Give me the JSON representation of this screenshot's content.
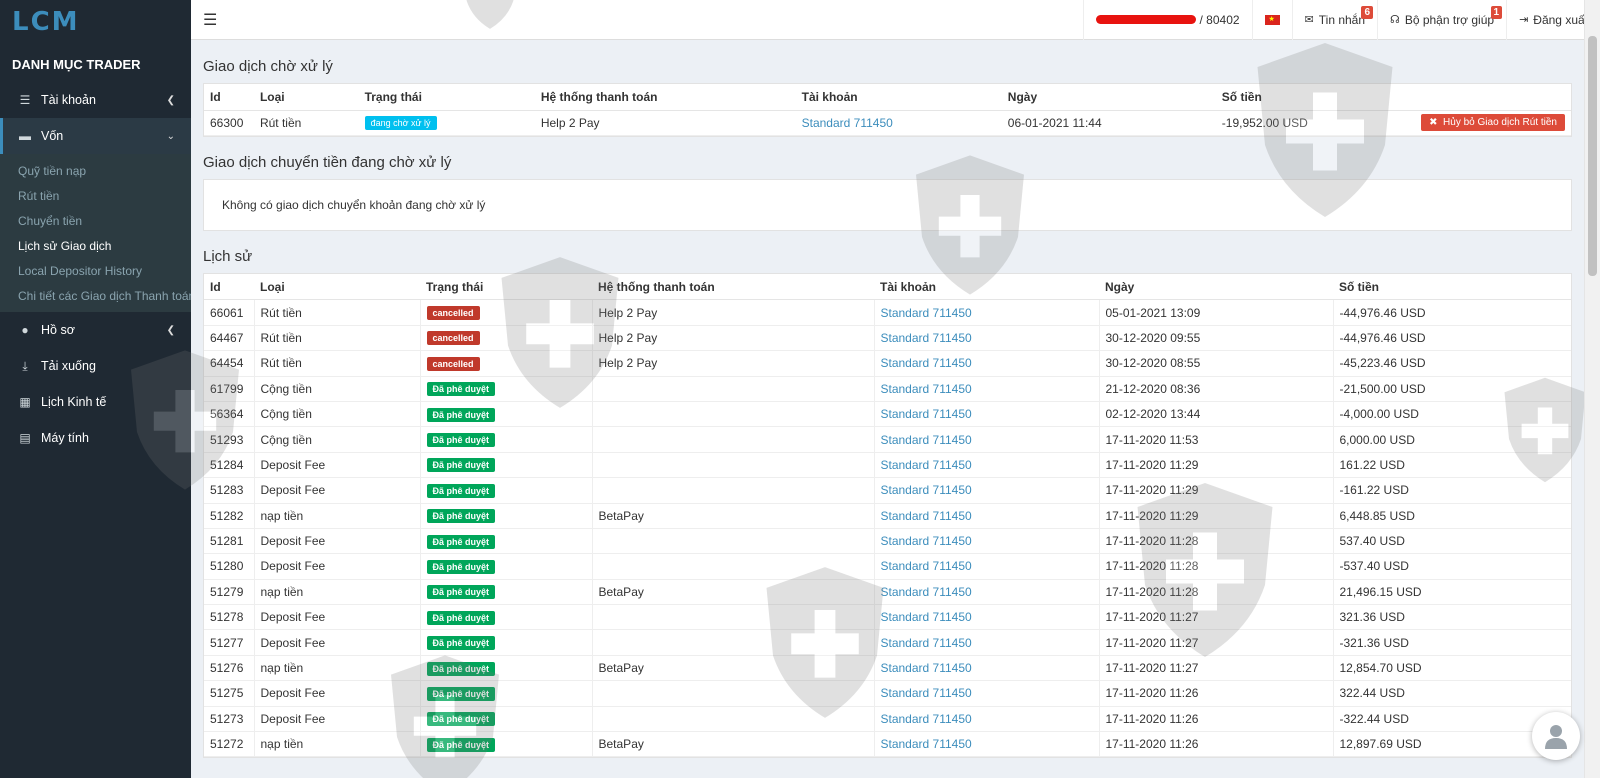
{
  "brand": {
    "logo": "LCM"
  },
  "sidebar": {
    "header": "DANH MỤC TRADER",
    "items": [
      {
        "label": "Tài khoản",
        "icon": "list-icon"
      },
      {
        "label": "Vốn",
        "icon": "wallet-icon"
      },
      {
        "label": "Hồ sơ",
        "icon": "user-icon"
      },
      {
        "label": "Tải xuống",
        "icon": "download-icon"
      },
      {
        "label": "Lịch Kinh tế",
        "icon": "calendar-icon"
      },
      {
        "label": "Máy tính",
        "icon": "calculator-icon"
      }
    ],
    "sub_items": [
      "Quỹ tiền nạp",
      "Rút tiền",
      "Chuyển tiền",
      "Lịch sử Giao dịch",
      "Local Depositor History",
      "Chi tiết các Giao dịch Thanh toán"
    ]
  },
  "topbar": {
    "account_suffix": "/ 80402",
    "messages_label": "Tin nhắn",
    "messages_count": "6",
    "support_label": "Bộ phận trợ giúp",
    "support_count": "1",
    "logout_label": "Đăng xuất"
  },
  "pending": {
    "title": "Giao dịch chờ xử lý",
    "headers": [
      "Id",
      "Loại",
      "Trạng thái",
      "Hệ thống thanh toán",
      "Tài khoản",
      "Ngày",
      "Số tiền"
    ],
    "row": {
      "id": "66300",
      "type": "Rút tiền",
      "status": "đang chờ xử lý",
      "system": "Help 2 Pay",
      "account": "Standard 711450",
      "date": "06-01-2021 11:44",
      "amount": "-19,952.00 USD",
      "cancel_button": "Hủy bỏ Giao dịch Rút tiền"
    }
  },
  "transfers": {
    "title": "Giao dịch chuyển tiền đang chờ xử lý",
    "empty": "Không có giao dịch chuyển khoản đang chờ xử lý"
  },
  "history": {
    "title": "Lịch sử",
    "headers": [
      "Id",
      "Loại",
      "Trạng thái",
      "Hệ thống thanh toán",
      "Tài khoản",
      "Ngày",
      "Số tiền"
    ],
    "rows": [
      {
        "id": "66061",
        "type": "Rút tiền",
        "status": "cancelled",
        "system": "Help 2 Pay",
        "account": "Standard 711450",
        "date": "05-01-2021 13:09",
        "amount": "-44,976.46 USD"
      },
      {
        "id": "64467",
        "type": "Rút tiền",
        "status": "cancelled",
        "system": "Help 2 Pay",
        "account": "Standard 711450",
        "date": "30-12-2020 09:55",
        "amount": "-44,976.46 USD"
      },
      {
        "id": "64454",
        "type": "Rút tiền",
        "status": "cancelled",
        "system": "Help 2 Pay",
        "account": "Standard 711450",
        "date": "30-12-2020 08:55",
        "amount": "-45,223.46 USD"
      },
      {
        "id": "61799",
        "type": "Cộng tiền",
        "status": "Đã phê duyệt",
        "system": "",
        "account": "Standard 711450",
        "date": "21-12-2020 08:36",
        "amount": "-21,500.00 USD"
      },
      {
        "id": "56364",
        "type": "Cộng tiền",
        "status": "Đã phê duyệt",
        "system": "",
        "account": "Standard 711450",
        "date": "02-12-2020 13:44",
        "amount": "-4,000.00 USD"
      },
      {
        "id": "51293",
        "type": "Cộng tiền",
        "status": "Đã phê duyệt",
        "system": "",
        "account": "Standard 711450",
        "date": "17-11-2020 11:53",
        "amount": "6,000.00 USD"
      },
      {
        "id": "51284",
        "type": "Deposit Fee",
        "status": "Đã phê duyệt",
        "system": "",
        "account": "Standard 711450",
        "date": "17-11-2020 11:29",
        "amount": "161.22 USD"
      },
      {
        "id": "51283",
        "type": "Deposit Fee",
        "status": "Đã phê duyệt",
        "system": "",
        "account": "Standard 711450",
        "date": "17-11-2020 11:29",
        "amount": "-161.22 USD"
      },
      {
        "id": "51282",
        "type": "nạp tiền",
        "status": "Đã phê duyệt",
        "system": "BetaPay",
        "account": "Standard 711450",
        "date": "17-11-2020 11:29",
        "amount": "6,448.85 USD"
      },
      {
        "id": "51281",
        "type": "Deposit Fee",
        "status": "Đã phê duyệt",
        "system": "",
        "account": "Standard 711450",
        "date": "17-11-2020 11:28",
        "amount": "537.40 USD"
      },
      {
        "id": "51280",
        "type": "Deposit Fee",
        "status": "Đã phê duyệt",
        "system": "",
        "account": "Standard 711450",
        "date": "17-11-2020 11:28",
        "amount": "-537.40 USD"
      },
      {
        "id": "51279",
        "type": "nạp tiền",
        "status": "Đã phê duyệt",
        "system": "BetaPay",
        "account": "Standard 711450",
        "date": "17-11-2020 11:28",
        "amount": "21,496.15 USD"
      },
      {
        "id": "51278",
        "type": "Deposit Fee",
        "status": "Đã phê duyệt",
        "system": "",
        "account": "Standard 711450",
        "date": "17-11-2020 11:27",
        "amount": "321.36 USD"
      },
      {
        "id": "51277",
        "type": "Deposit Fee",
        "status": "Đã phê duyệt",
        "system": "",
        "account": "Standard 711450",
        "date": "17-11-2020 11:27",
        "amount": "-321.36 USD"
      },
      {
        "id": "51276",
        "type": "nạp tiền",
        "status": "Đã phê duyệt",
        "system": "BetaPay",
        "account": "Standard 711450",
        "date": "17-11-2020 11:27",
        "amount": "12,854.70 USD"
      },
      {
        "id": "51275",
        "type": "Deposit Fee",
        "status": "Đã phê duyệt",
        "system": "",
        "account": "Standard 711450",
        "date": "17-11-2020 11:26",
        "amount": "322.44 USD"
      },
      {
        "id": "51273",
        "type": "Deposit Fee",
        "status": "Đã phê duyệt",
        "system": "",
        "account": "Standard 711450",
        "date": "17-11-2020 11:26",
        "amount": "-322.44 USD"
      },
      {
        "id": "51272",
        "type": "nạp tiền",
        "status": "Đã phê duyệt",
        "system": "BetaPay",
        "account": "Standard 711450",
        "date": "17-11-2020 11:26",
        "amount": "12,897.69 USD"
      }
    ]
  },
  "colors": {
    "sidebar_bg": "#1f2933",
    "link": "#3c8dbc",
    "danger": "#dd4b39",
    "success": "#00a65a",
    "info": "#00c0ef"
  }
}
